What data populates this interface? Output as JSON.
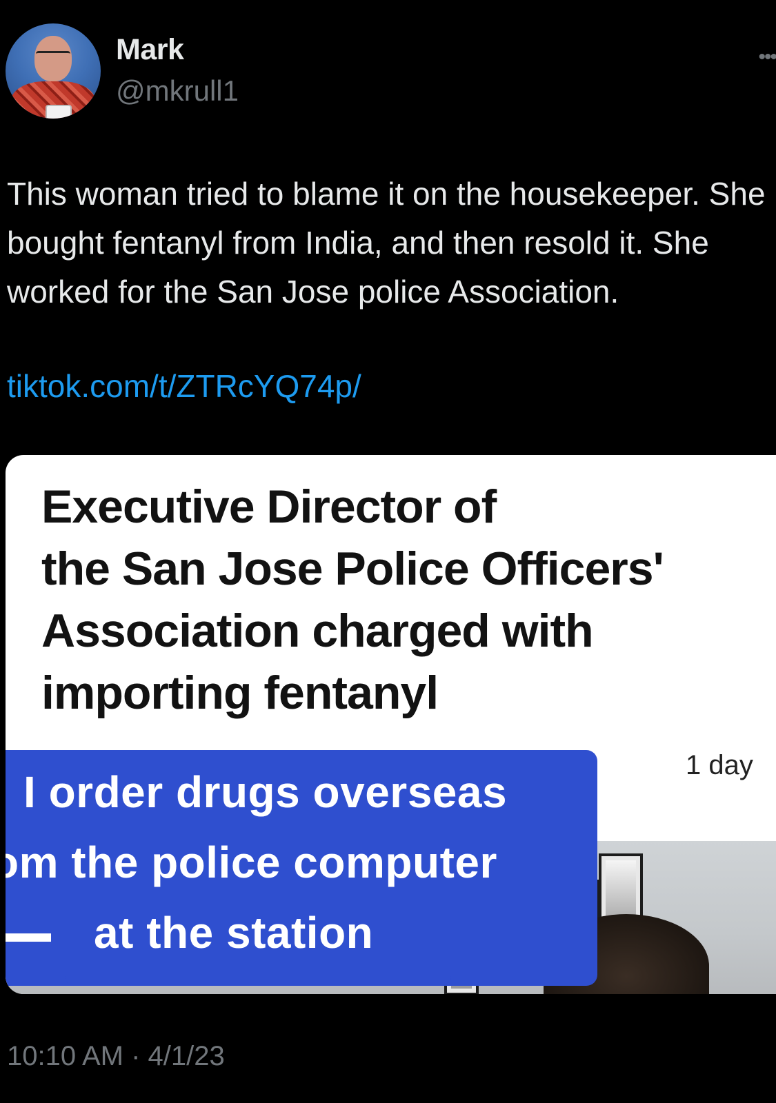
{
  "author": {
    "name": "Mark",
    "handle": "@mkrull1",
    "avatar_icon": "profile-photo"
  },
  "menu_icon": "more-options-icon",
  "tweet": {
    "text": "This woman tried to blame it on the housekeeper. She bought fentanyl from India, and then resold it. She worked for the San Jose police Association.",
    "link": "tiktok.com/t/ZTRcYQ74p/",
    "timestamp": "10:10 AM · 4/1/23"
  },
  "media": {
    "headline": "Executive Director of\nthe San Jose Police Officers'\nAssociation charged with\nimporting fentanyl",
    "time_ago": "1 day",
    "caption_lines": [
      "I order drugs overseas",
      "om the police computer",
      "at the station"
    ]
  },
  "colors": {
    "background": "#000000",
    "link": "#1d9bf0",
    "secondary_text": "#71767b",
    "caption_bg": "#2f4fcf"
  }
}
